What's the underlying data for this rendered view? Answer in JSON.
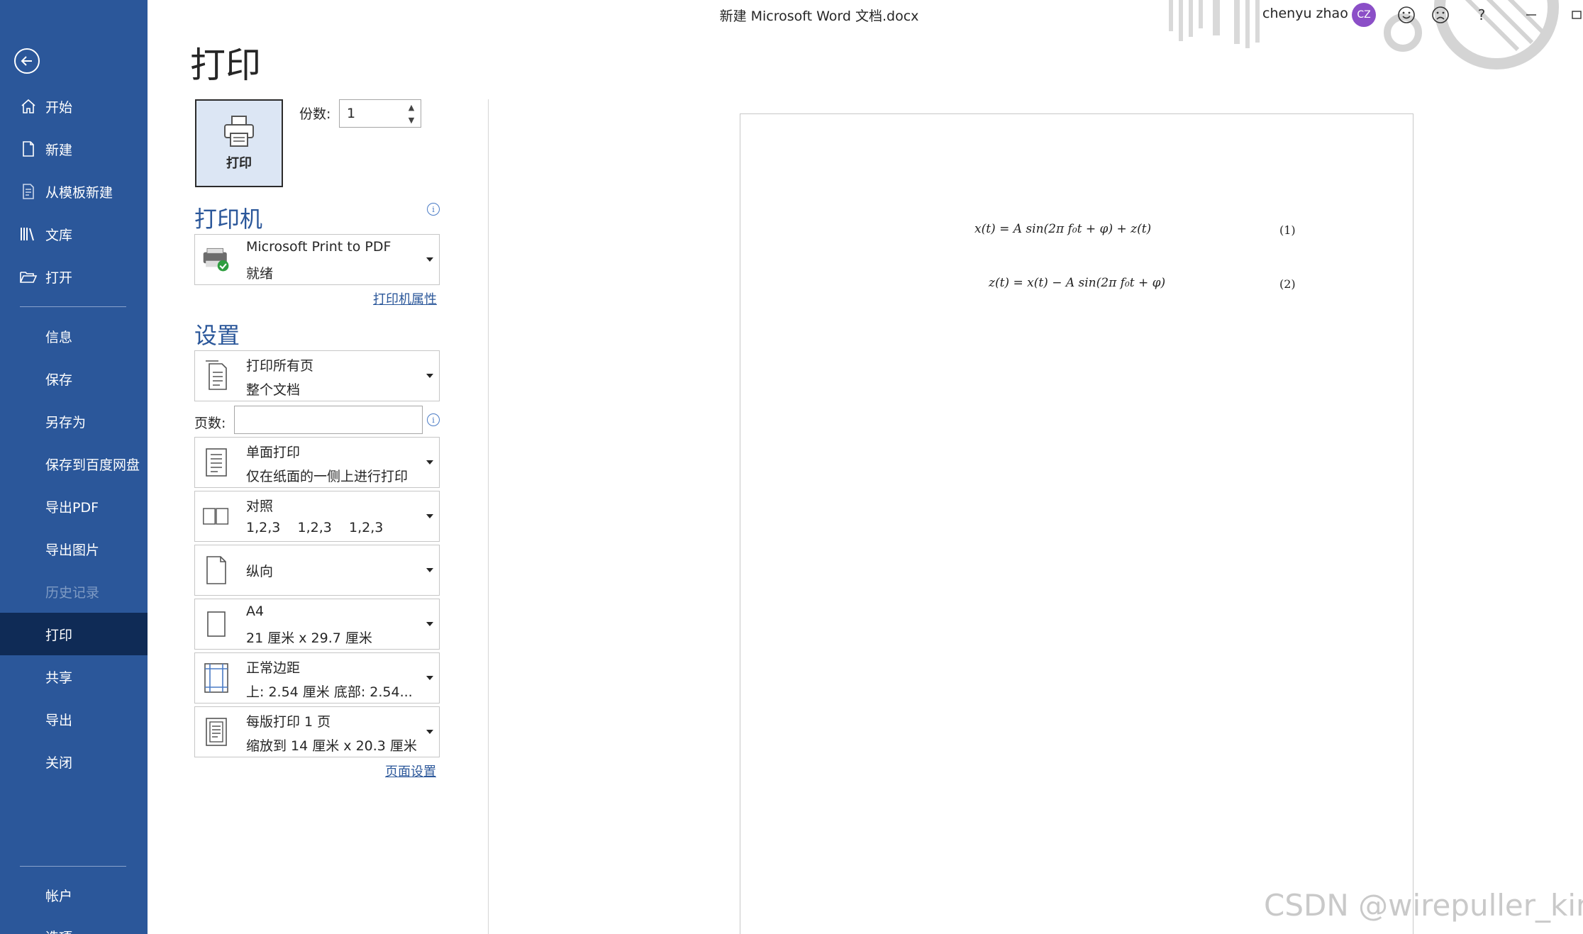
{
  "window": {
    "doc_title": "新建 Microsoft Word 文档.docx",
    "user_name": "chenyu zhao",
    "user_initials": "CZ"
  },
  "sidebar": {
    "top_items": [
      {
        "label": "开始",
        "icon": "home-icon"
      },
      {
        "label": "新建",
        "icon": "new-document-icon"
      },
      {
        "label": "从模板新建",
        "icon": "template-icon"
      },
      {
        "label": "文库",
        "icon": "library-icon"
      },
      {
        "label": "打开",
        "icon": "open-folder-icon"
      }
    ],
    "items": [
      "信息",
      "保存",
      "另存为",
      "保存到百度网盘",
      "导出PDF",
      "导出图片",
      "历史记录",
      "打印",
      "共享",
      "导出",
      "关闭"
    ],
    "selected": "打印",
    "disabled": "历史记录",
    "bottom_items": [
      "帐户",
      "选项"
    ]
  },
  "print": {
    "heading": "打印",
    "button_label": "打印",
    "copies_label": "份数:",
    "copies_value": "1"
  },
  "printer": {
    "heading": "打印机",
    "name": "Microsoft Print to PDF",
    "status": "就绪",
    "properties_link": "打印机属性"
  },
  "settings": {
    "heading": "设置",
    "pages_label": "页数:",
    "pages_value": "",
    "options": [
      {
        "line1": "打印所有页",
        "line2": "整个文档",
        "icon": "all-pages-icon"
      },
      {
        "line1": "单面打印",
        "line2": "仅在纸面的一侧上进行打印",
        "icon": "one-sided-icon"
      },
      {
        "line1": "对照",
        "line2": "1,2,3    1,2,3    1,2,3",
        "icon": "collated-icon"
      },
      {
        "line1": "纵向",
        "line2": "",
        "icon": "portrait-icon"
      },
      {
        "line1": "A4",
        "line2": "21 厘米 x 29.7 厘米",
        "icon": "paper-size-icon"
      },
      {
        "line1": "正常边距",
        "line2": "上: 2.54 厘米 底部: 2.54...",
        "icon": "margins-icon"
      },
      {
        "line1": "每版打印 1 页",
        "line2": "缩放到 14 厘米 x 20.3 厘米",
        "icon": "pages-per-sheet-icon"
      }
    ],
    "page_setup_link": "页面设置"
  },
  "preview": {
    "equations": [
      {
        "text": "x(t) = A sin(2π f₀t + φ) + z(t)",
        "number": "(1)"
      },
      {
        "text": "z(t) = x(t) − A sin(2π f₀t + φ)",
        "number": "(2)"
      }
    ]
  },
  "watermark": "CSDN @wirepuller_king",
  "colors": {
    "sidebar": "#2b579a",
    "sidebar_selected": "#0f2b56",
    "accent": "#2b579a",
    "avatar": "#8b4fc7"
  }
}
